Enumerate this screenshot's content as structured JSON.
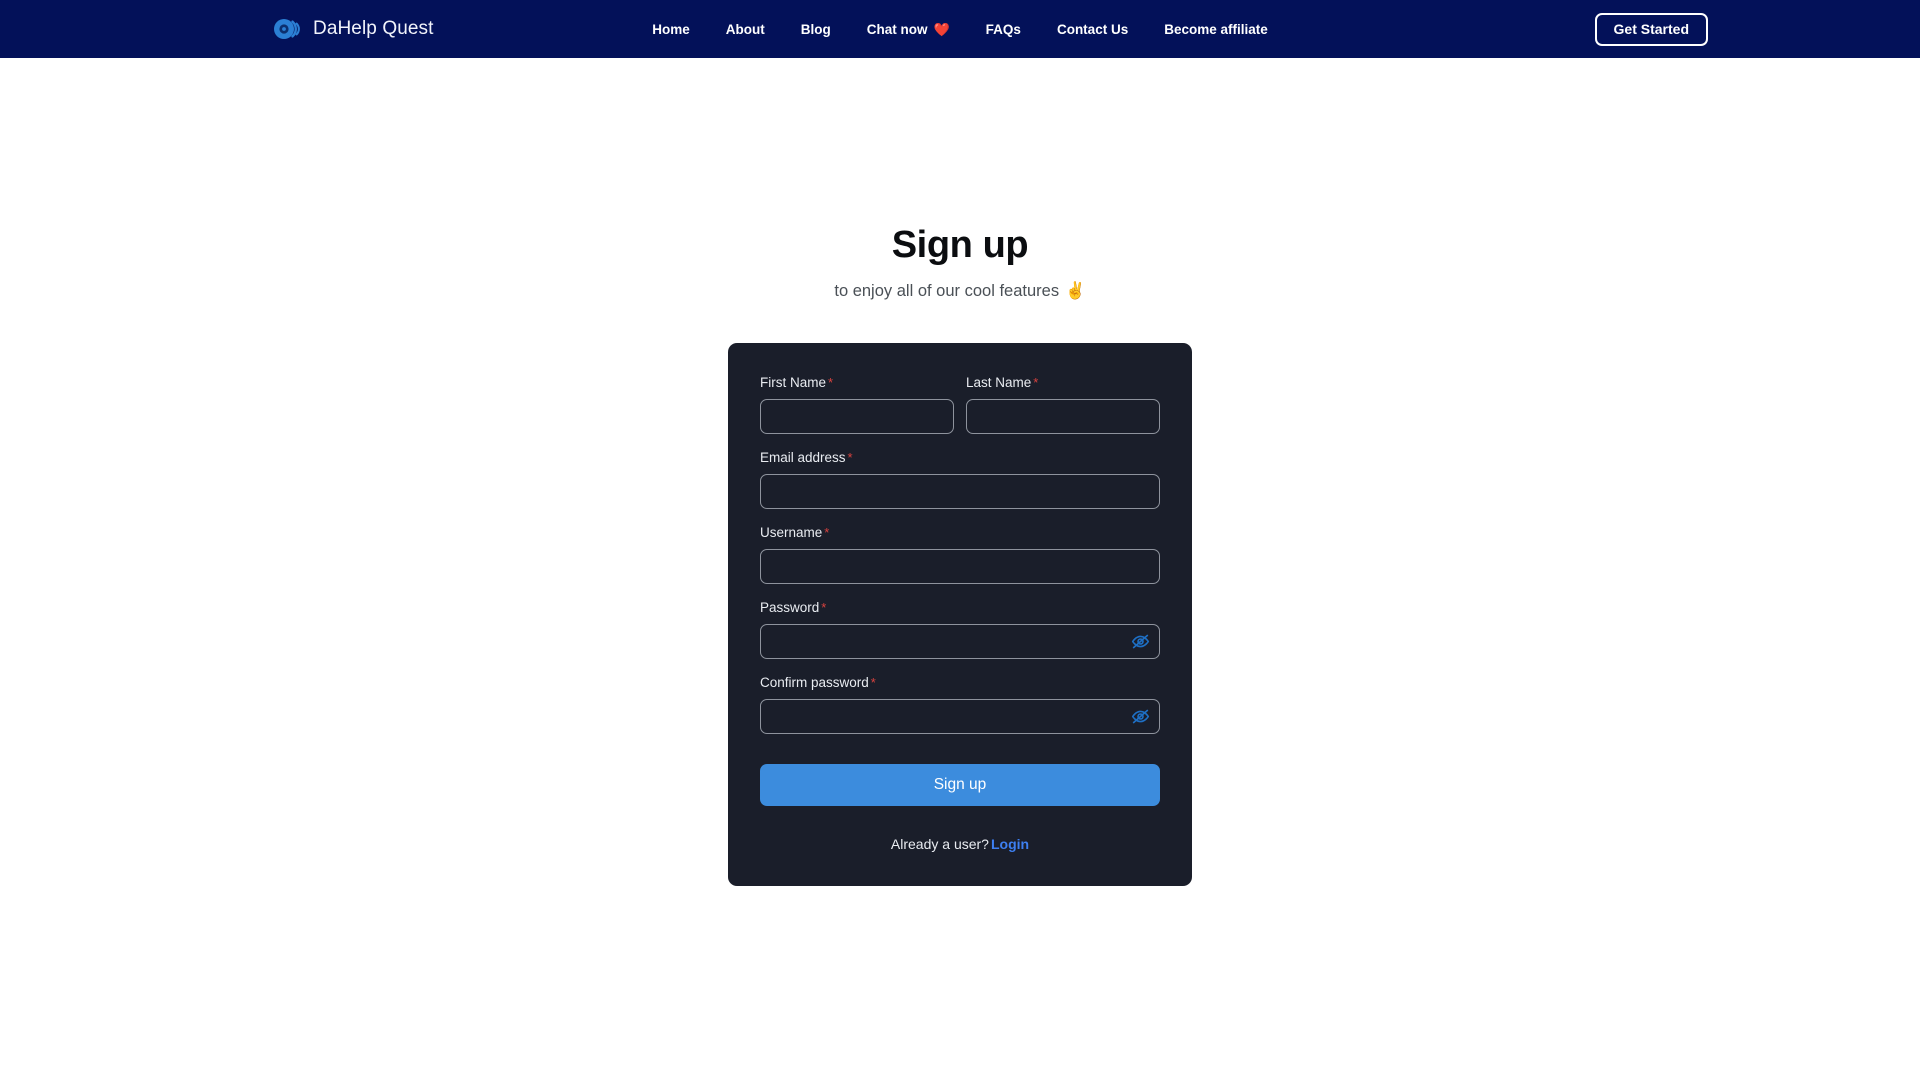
{
  "header": {
    "brand": {
      "name": "DaHelp Quest",
      "logo_icon": "concentric-circle-logo-icon",
      "logo_color": "#2b7fd4"
    },
    "nav": [
      {
        "label": "Home",
        "emoji": ""
      },
      {
        "label": "About",
        "emoji": ""
      },
      {
        "label": "Blog",
        "emoji": ""
      },
      {
        "label": "Chat now",
        "emoji": "❤️"
      },
      {
        "label": "FAQs",
        "emoji": ""
      },
      {
        "label": "Contact Us",
        "emoji": ""
      },
      {
        "label": "Become affiliate",
        "emoji": ""
      }
    ],
    "cta_label": "Get Started",
    "background_color": "#031159"
  },
  "main": {
    "title": "Sign up",
    "subtitle_text": "to enjoy all of our cool features",
    "subtitle_emoji": "✌️",
    "form": {
      "required_marker": "*",
      "fields": [
        {
          "label": "First Name",
          "value": "",
          "placeholder": "",
          "type": "text",
          "required": true
        },
        {
          "label": "Last Name",
          "value": "",
          "placeholder": "",
          "type": "text",
          "required": true
        },
        {
          "label": "Email address",
          "value": "",
          "placeholder": "",
          "type": "email",
          "required": true
        },
        {
          "label": "Username",
          "value": "",
          "placeholder": "",
          "type": "text",
          "required": true
        },
        {
          "label": "Password",
          "value": "",
          "placeholder": "",
          "type": "password",
          "required": true
        },
        {
          "label": "Confirm password",
          "value": "",
          "placeholder": "",
          "type": "password",
          "required": true
        }
      ],
      "password_toggle_icon": "eye-off-icon",
      "submit_label": "Sign up",
      "submit_color": "#3c8cdd"
    },
    "footer": {
      "prompt": "Already a user?",
      "link_label": "Login",
      "link_color": "#3d7ff0"
    },
    "card_background": "#1a1e2a"
  }
}
